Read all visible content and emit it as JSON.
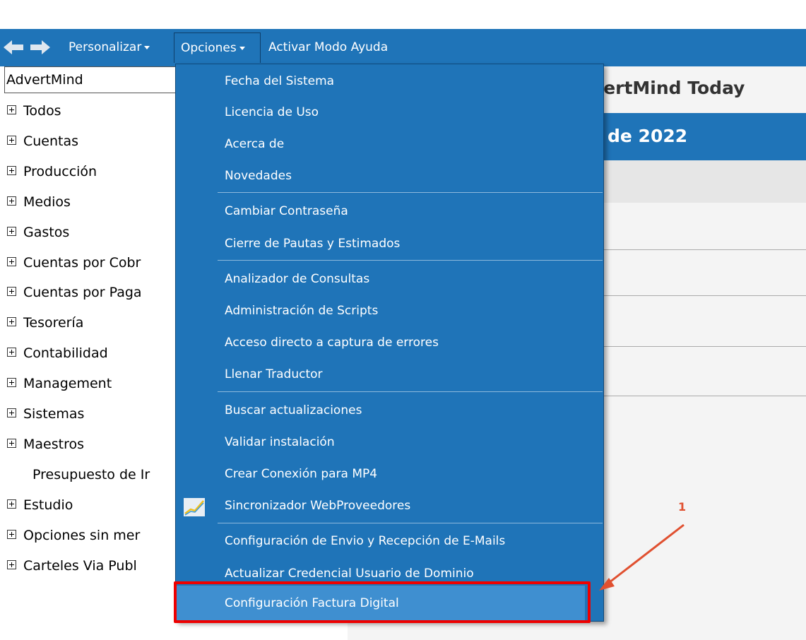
{
  "toolbar": {
    "personalizar": "Personalizar",
    "opciones": "Opciones",
    "ayuda": "Activar Modo Ayuda"
  },
  "sidebar": {
    "title": "AdvertMind",
    "items": [
      {
        "label": "Todos",
        "expandable": true
      },
      {
        "label": "Cuentas",
        "expandable": true
      },
      {
        "label": "Producción",
        "expandable": true
      },
      {
        "label": "Medios",
        "expandable": true
      },
      {
        "label": "Gastos",
        "expandable": true
      },
      {
        "label": "Cuentas por Cobr",
        "expandable": true
      },
      {
        "label": "Cuentas por Paga",
        "expandable": true
      },
      {
        "label": "Tesorería",
        "expandable": true
      },
      {
        "label": "Contabilidad",
        "expandable": true
      },
      {
        "label": "Management",
        "expandable": true
      },
      {
        "label": "Sistemas",
        "expandable": true
      },
      {
        "label": "Maestros",
        "expandable": true
      },
      {
        "label": "Presupuesto de Ir",
        "expandable": false
      },
      {
        "label": "Estudio",
        "expandable": true
      },
      {
        "label": "Opciones sin mer",
        "expandable": true
      },
      {
        "label": "Carteles Via Publ",
        "expandable": true
      }
    ]
  },
  "main": {
    "title": "dvertMind Today",
    "date": "de 2022"
  },
  "menu": {
    "items": [
      "Fecha del Sistema",
      "Licencia de Uso",
      "Acerca de",
      "Novedades",
      "Cambiar Contraseña",
      "Cierre de Pautas y Estimados",
      "Analizador de Consultas",
      "Administración de Scripts",
      "Acceso directo a captura de errores",
      "Llenar Traductor",
      "Buscar actualizaciones",
      "Validar instalación",
      "Crear Conexión para MP4",
      "Sincronizador WebProveedores",
      "Configuración de Envio y Recepción de E-Mails",
      "Actualizar Credencial Usuario de Dominio"
    ],
    "highlighted": "Configuración Factura Digital"
  },
  "annotation": {
    "number": "1"
  },
  "colors": {
    "toolbar": "#1f74b8",
    "menu_bg": "#1f74b8",
    "highlight": "#3f8fd0",
    "annotation_red": "#ee0000"
  }
}
